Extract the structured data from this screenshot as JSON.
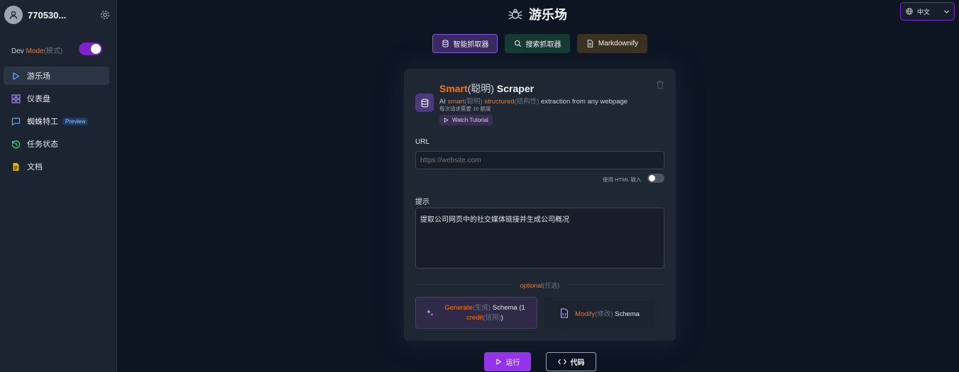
{
  "sidebar": {
    "username": "770530...",
    "dev_mode": {
      "prefix": "Dev ",
      "highlight": "Mode",
      "suffix": "(模式)",
      "enabled": true
    },
    "items": [
      {
        "label": "游乐场",
        "icon": "play-icon",
        "active": true
      },
      {
        "label": "仪表盘",
        "icon": "dashboard-icon"
      },
      {
        "label": "蜘蛛特工",
        "icon": "chat-icon",
        "badge": "Preview"
      },
      {
        "label": "任务状态",
        "icon": "history-icon"
      },
      {
        "label": "文档",
        "icon": "document-icon"
      }
    ]
  },
  "header": {
    "title": "游乐场",
    "language": "中文"
  },
  "tabs": [
    {
      "label": "智能抓取器",
      "icon": "database-icon",
      "active": true
    },
    {
      "label": "搜索抓取器",
      "icon": "search-icon"
    },
    {
      "label": "Markdownify",
      "icon": "file-icon"
    }
  ],
  "card": {
    "title_hl": "Smart",
    "title_dim": "(聪明)",
    "title_rest": " Scraper",
    "desc": {
      "p1": "AI ",
      "h1": "smart",
      "d1": "(聪明)",
      "sp": " ",
      "h2": "structured",
      "d2": "(结构性)",
      "rest": " extraction from any webpage"
    },
    "credits": "每次请求需要 10 额度",
    "watch_label": "Watch Tutorial",
    "url_label": "URL",
    "url_placeholder": "https://website.com",
    "html_toggle_label": "使用 HTML 输入",
    "prompt_label": "提示",
    "prompt_value": "提取公司网页中的社交媒体链接并生成公司概况",
    "optional_hl": "optional",
    "optional_dim": "(任选)",
    "generate": {
      "h1": "Generate",
      "d1": "(生成)",
      "t1": " Schema (1 ",
      "h2": "credit",
      "d2": "(信用)",
      "t2": ")"
    },
    "modify": {
      "h1": "Modify",
      "d1": "(修改)",
      "t1": " Schema"
    }
  },
  "actions": {
    "run_label": "运行",
    "code_label": "代码"
  }
}
